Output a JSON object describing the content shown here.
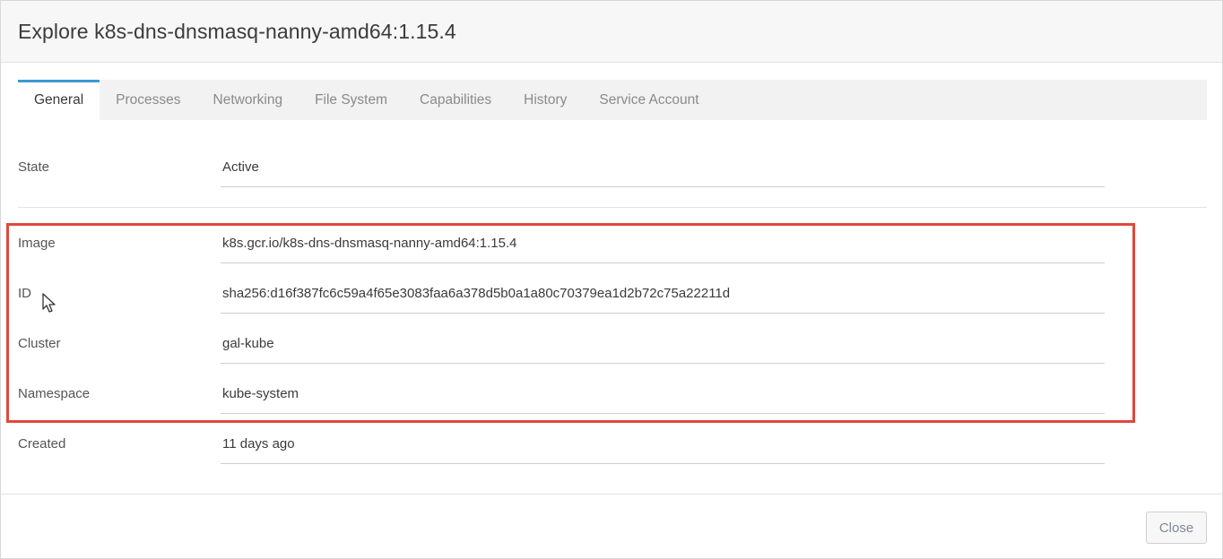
{
  "modal": {
    "title": "Explore k8s-dns-dnsmasq-nanny-amd64:1.15.4"
  },
  "tabs": [
    {
      "label": "General",
      "active": true
    },
    {
      "label": "Processes",
      "active": false
    },
    {
      "label": "Networking",
      "active": false
    },
    {
      "label": "File System",
      "active": false
    },
    {
      "label": "Capabilities",
      "active": false
    },
    {
      "label": "History",
      "active": false
    },
    {
      "label": "Service Account",
      "active": false
    }
  ],
  "fields": {
    "state": {
      "label": "State",
      "value": "Active"
    },
    "image": {
      "label": "Image",
      "value": "k8s.gcr.io/k8s-dns-dnsmasq-nanny-amd64:1.15.4"
    },
    "id": {
      "label": "ID",
      "value": "sha256:d16f387fc6c59a4f65e3083faa6a378d5b0a1a80c70379ea1d2b72c75a22211d"
    },
    "cluster": {
      "label": "Cluster",
      "value": "gal-kube"
    },
    "namespace": {
      "label": "Namespace",
      "value": "kube-system"
    },
    "created": {
      "label": "Created",
      "value": "11 days ago"
    }
  },
  "footer": {
    "close_label": "Close"
  },
  "colors": {
    "active_tab_accent": "#3d98d3",
    "highlight_border": "#e0483b"
  },
  "icons": {
    "cursor": "mouse-pointer-icon"
  }
}
